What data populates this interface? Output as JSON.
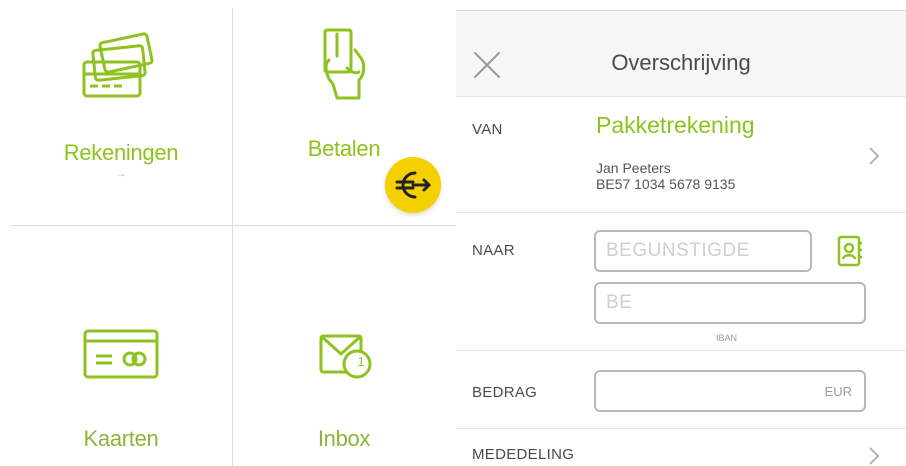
{
  "tiles": {
    "rekeningen": {
      "label": "Rekeningen",
      "sub": "→"
    },
    "betalen": {
      "label": "Betalen"
    },
    "kaarten": {
      "label": "Kaarten"
    },
    "inbox": {
      "label": "Inbox",
      "badge": "1"
    }
  },
  "fab": {
    "icon": "euro-transfer-icon",
    "color": "#f5d000"
  },
  "form": {
    "title": "Overschrijving",
    "van": {
      "label": "VAN",
      "account_name": "Pakketrekening",
      "holder": "Jan Peeters",
      "iban": "BE57 1034 5678 9135"
    },
    "naar": {
      "label": "NAAR",
      "beneficiary_placeholder": "BEGUNSTIGDE",
      "iban_placeholder": "BE",
      "iban_caption": "IBAN"
    },
    "bedrag": {
      "label": "BEDRAG",
      "currency": "EUR"
    },
    "mededeling": {
      "label": "MEDEDELING"
    }
  },
  "colors": {
    "accent": "#8ec21f",
    "fab": "#f5d000",
    "text": "#4a4a4a"
  }
}
